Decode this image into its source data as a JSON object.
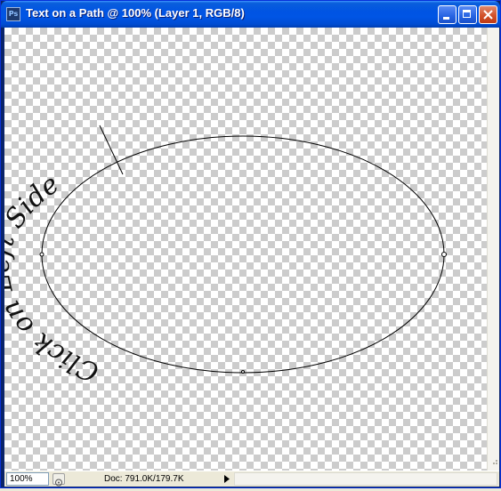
{
  "window": {
    "title": "Text on a Path @ 100% (Layer 1, RGB/8)",
    "app_icon_label": "Ps"
  },
  "canvas": {
    "path_text": "Click on Left Side"
  },
  "statusbar": {
    "zoom": "100%",
    "doc_info": "Doc: 791.0K/179.7K"
  },
  "colors": {
    "titlebar": "#0054E3",
    "close_button": "#D2522A",
    "checker_light": "#FFFFFF",
    "checker_dark": "#CCCCCC",
    "path_stroke": "#000000"
  },
  "icons": [
    "photoshop-app-icon",
    "minimize-icon",
    "maximize-icon",
    "close-icon",
    "status-menu-arrow-icon"
  ]
}
